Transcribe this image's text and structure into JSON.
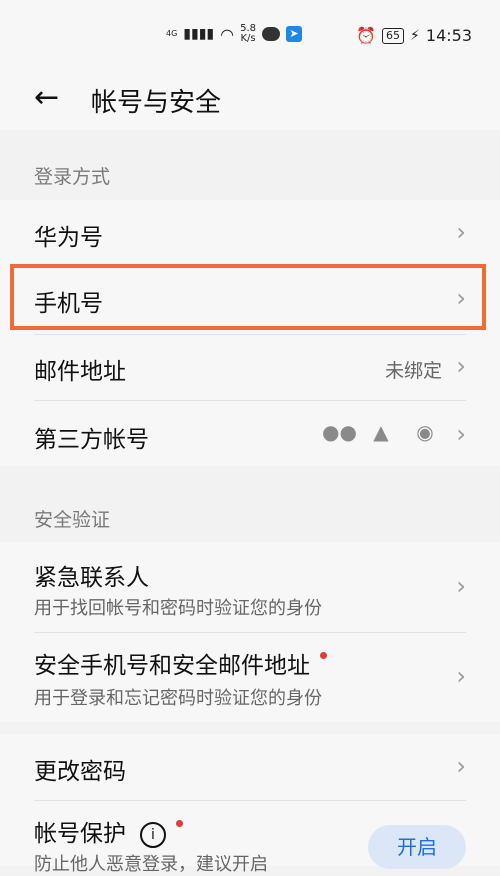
{
  "status_bar": {
    "network": "4G",
    "speed_value": "5.8",
    "speed_unit": "K/s",
    "battery": "65",
    "time": "14:53"
  },
  "header": {
    "back_icon": "arrow-left-icon",
    "title": "帐号与安全"
  },
  "sections": {
    "login": {
      "label": "登录方式",
      "items": [
        {
          "label": "华为号",
          "value": ""
        },
        {
          "label": "手机号",
          "value": ""
        },
        {
          "label": "邮件地址",
          "value": "未绑定"
        },
        {
          "label": "第三方帐号",
          "icons": [
            "wechat-icon",
            "qq-icon",
            "weibo-icon"
          ]
        }
      ]
    },
    "security": {
      "label": "安全验证",
      "items": [
        {
          "label": "紧急联系人",
          "sub": "用于找回帐号和密码时验证您的身份"
        },
        {
          "label": "安全手机号和安全邮件地址",
          "sub": "用于登录和忘记密码时验证您的身份"
        }
      ]
    },
    "password": {
      "items": [
        {
          "label": "更改密码"
        },
        {
          "label": "帐号保护",
          "sub": "防止他人恶意登录，建议开启",
          "button": "开启"
        }
      ]
    }
  }
}
